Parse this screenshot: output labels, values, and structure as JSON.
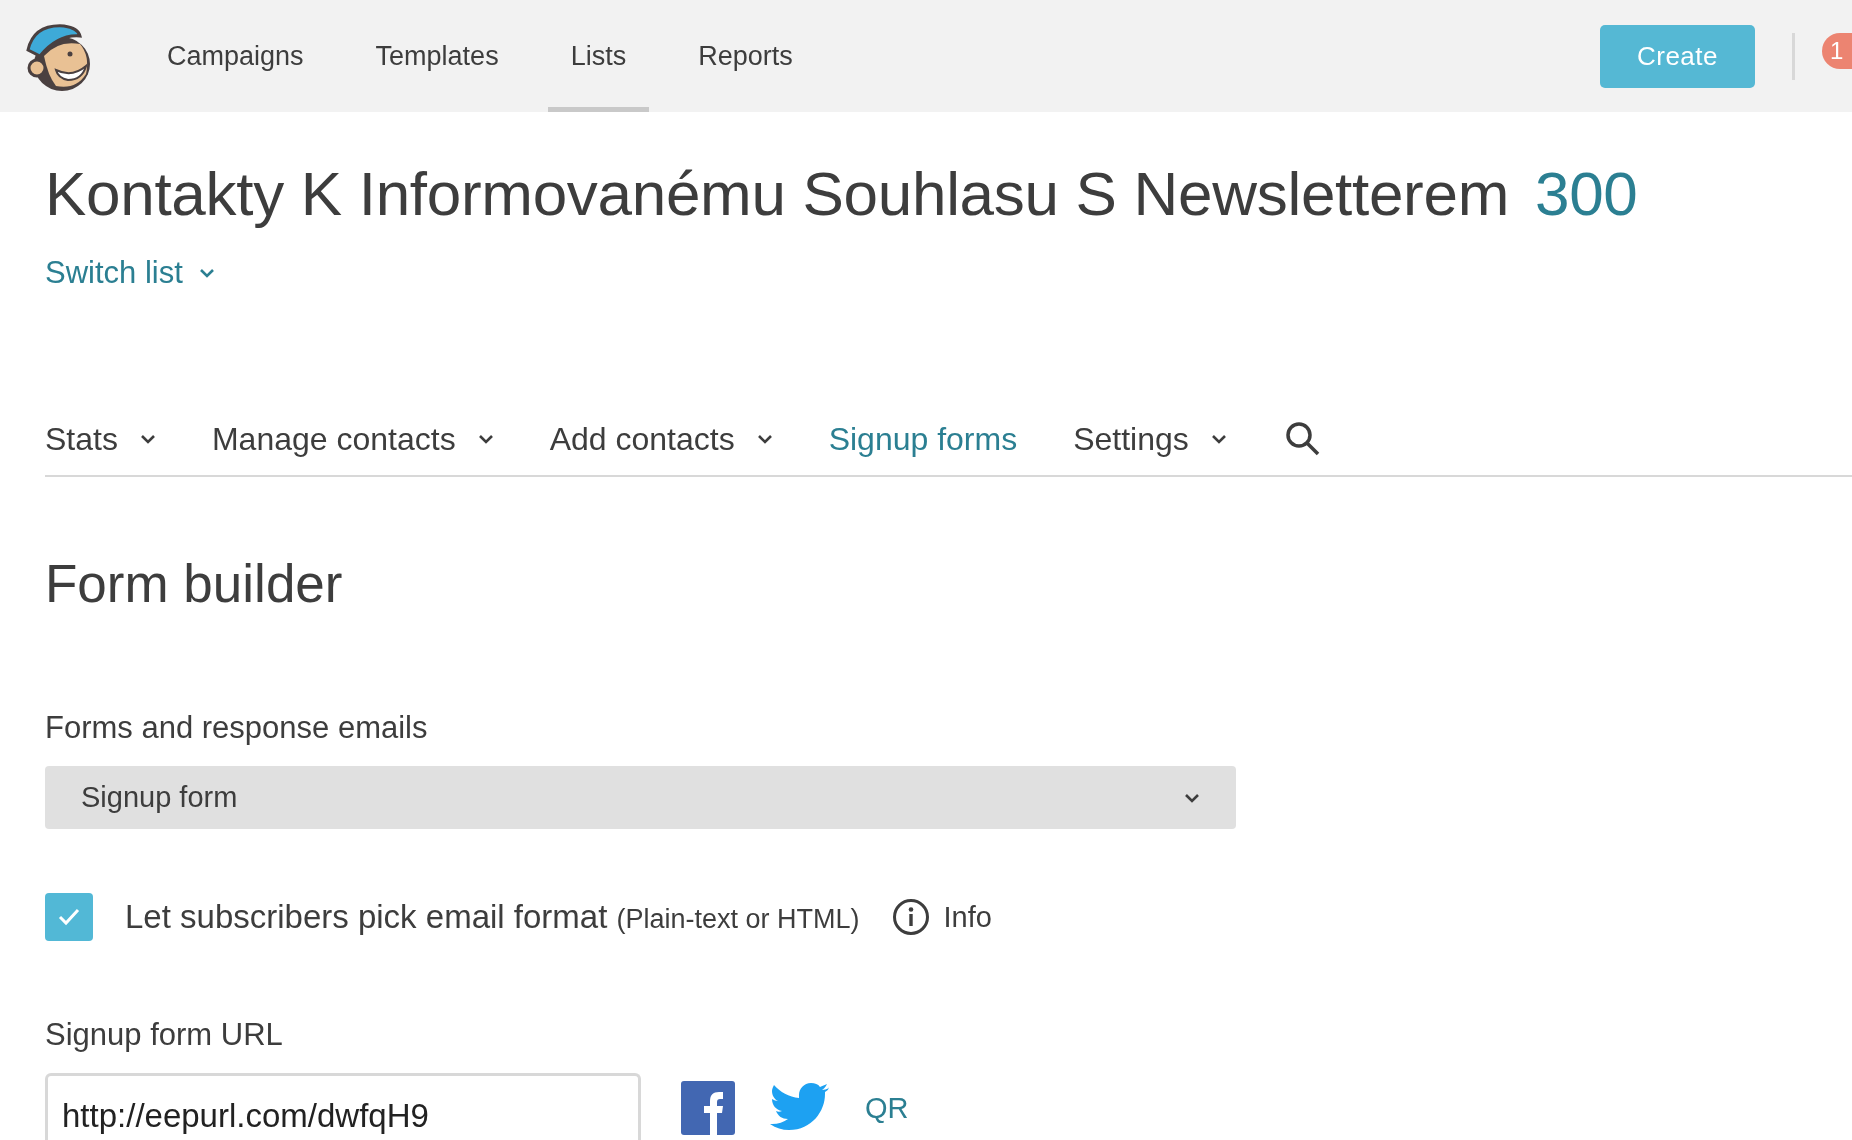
{
  "header": {
    "nav": [
      {
        "label": "Campaigns",
        "selected": false
      },
      {
        "label": "Templates",
        "selected": false
      },
      {
        "label": "Lists",
        "selected": true
      },
      {
        "label": "Reports",
        "selected": false
      }
    ],
    "create_button": "Create",
    "notification_count": "1"
  },
  "list": {
    "title": "Kontakty K Informovanému Souhlasu S Newsletterem",
    "count": "300",
    "switch_link": "Switch list"
  },
  "tabs": [
    {
      "label": "Stats",
      "dropdown": true,
      "selected": false
    },
    {
      "label": "Manage contacts",
      "dropdown": true,
      "selected": false
    },
    {
      "label": "Add contacts",
      "dropdown": true,
      "selected": false
    },
    {
      "label": "Signup forms",
      "dropdown": false,
      "selected": true
    },
    {
      "label": "Settings",
      "dropdown": true,
      "selected": false
    }
  ],
  "form_builder": {
    "heading": "Form builder",
    "forms_label": "Forms and response emails",
    "forms_select": "Signup form",
    "format_option": {
      "label": "Let subscribers pick email format",
      "hint": "(Plain-text or HTML)",
      "checked": true
    },
    "info_link": "Info",
    "url_label": "Signup form URL",
    "url_value": "http://eepurl.com/dwfqH9",
    "share": [
      {
        "kind": "facebook"
      },
      {
        "kind": "twitter"
      },
      {
        "kind": "text",
        "label": "QR"
      }
    ]
  }
}
